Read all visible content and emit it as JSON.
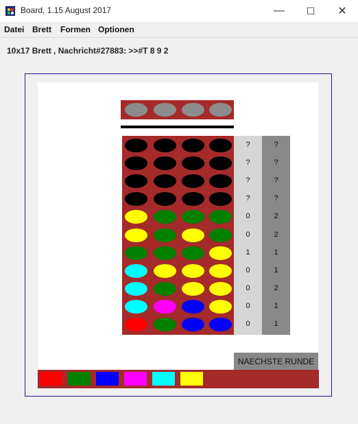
{
  "window": {
    "title": "Board, 1.15 August 2017",
    "minimize_glyph": "—",
    "maximize_glyph": "☐",
    "close_glyph": "✕"
  },
  "menu": [
    "Datei",
    "Brett",
    "Formen",
    "Optionen"
  ],
  "status_line": "10x17 Brett , Nachricht#27883: >>#T 8 9 2",
  "colors": {
    "board": "#a52a2a",
    "hidden_peg": "#888888",
    "empty_hole": "#000000",
    "score_light": "#d6d6d6",
    "score_dark": "#888888"
  },
  "secret_row": [
    "gray",
    "gray",
    "gray",
    "gray"
  ],
  "rows": [
    {
      "pegs": [
        "black",
        "black",
        "black",
        "black"
      ],
      "score_a": "?",
      "score_b": "?"
    },
    {
      "pegs": [
        "black",
        "black",
        "black",
        "black"
      ],
      "score_a": "?",
      "score_b": "?"
    },
    {
      "pegs": [
        "black",
        "black",
        "black",
        "black"
      ],
      "score_a": "?",
      "score_b": "?"
    },
    {
      "pegs": [
        "black",
        "black",
        "black",
        "black"
      ],
      "score_a": "?",
      "score_b": "?"
    },
    {
      "pegs": [
        "yellow",
        "green",
        "green",
        "green"
      ],
      "score_a": "0",
      "score_b": "2"
    },
    {
      "pegs": [
        "yellow",
        "green",
        "yellow",
        "green"
      ],
      "score_a": "0",
      "score_b": "2"
    },
    {
      "pegs": [
        "green",
        "green",
        "green",
        "yellow"
      ],
      "score_a": "1",
      "score_b": "1"
    },
    {
      "pegs": [
        "cyan",
        "yellow",
        "yellow",
        "yellow"
      ],
      "score_a": "0",
      "score_b": "1"
    },
    {
      "pegs": [
        "cyan",
        "green",
        "yellow",
        "yellow"
      ],
      "score_a": "0",
      "score_b": "2"
    },
    {
      "pegs": [
        "cyan",
        "magenta",
        "blue",
        "yellow"
      ],
      "score_a": "0",
      "score_b": "1"
    },
    {
      "pegs": [
        "red",
        "green",
        "blue",
        "blue"
      ],
      "score_a": "0",
      "score_b": "1"
    }
  ],
  "peg_colors": {
    "gray": "#8c8c8c",
    "black": "#000000",
    "yellow": "#ffff00",
    "green": "#008000",
    "cyan": "#00ffff",
    "magenta": "#ff00ff",
    "blue": "#0000ff",
    "red": "#ff0000"
  },
  "next_round_label": "NAECHSTE RUNDE",
  "palette": [
    "#ff0000",
    "#008000",
    "#0000ff",
    "#ff00ff",
    "#00ffff",
    "#ffff00"
  ]
}
